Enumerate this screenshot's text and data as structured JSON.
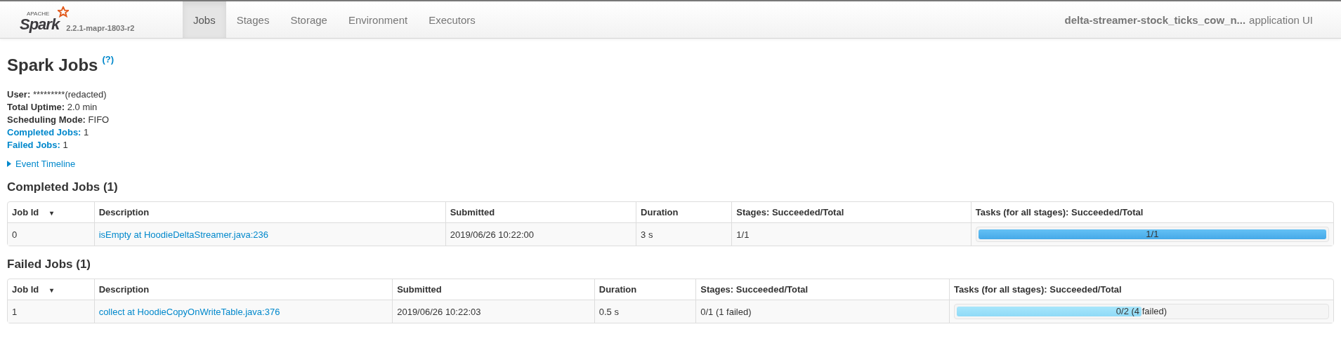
{
  "navbar": {
    "logo": {
      "small": "APACHE",
      "name": "Spark"
    },
    "version": "2.2.1-mapr-1803-r2",
    "tabs": [
      {
        "label": "Jobs",
        "selected": true
      },
      {
        "label": "Stages",
        "selected": false
      },
      {
        "label": "Storage",
        "selected": false
      },
      {
        "label": "Environment",
        "selected": false
      },
      {
        "label": "Executors",
        "selected": false
      }
    ],
    "app_name": "delta-streamer-stock_ticks_cow_n...",
    "app_suffix": "application UI"
  },
  "title": "Spark Jobs",
  "help": "(?)",
  "summary": [
    {
      "label": "User:",
      "value": "*********(redacted)",
      "link": false
    },
    {
      "label": "Total Uptime:",
      "value": "2.0 min",
      "link": false
    },
    {
      "label": "Scheduling Mode:",
      "value": "FIFO",
      "link": false
    },
    {
      "label": "Completed Jobs:",
      "value": "1",
      "link": true
    },
    {
      "label": "Failed Jobs:",
      "value": "1",
      "link": true
    }
  ],
  "event_timeline": {
    "label": "Event Timeline",
    "expanded": false
  },
  "sections": [
    {
      "title": "Completed Jobs (1)",
      "columns": [
        "Job Id",
        "Description",
        "Submitted",
        "Duration",
        "Stages: Succeeded/Total",
        "Tasks (for all stages): Succeeded/Total"
      ],
      "sort_mark": "▾",
      "rows": [
        {
          "id": "0",
          "description": "isEmpty at HoodieDeltaStreamer.java:236",
          "submitted": "2019/06/26 10:22:00",
          "duration": "3 s",
          "stages": "1/1",
          "tasks": {
            "label": "1/1",
            "level": 1,
            "kind": "completed"
          }
        }
      ]
    },
    {
      "title": "Failed Jobs (1)",
      "columns": [
        "Job Id",
        "Description",
        "Submitted",
        "Duration",
        "Stages: Succeeded/Total",
        "Tasks (for all stages): Succeeded/Total"
      ],
      "sort_mark": "▾",
      "rows": [
        {
          "id": "1",
          "description": "collect at HoodieCopyOnWriteTable.java:376",
          "submitted": "2019/06/26 10:22:03",
          "duration": "0.5 s",
          "stages": "0/1 (1 failed)",
          "tasks": {
            "label": "0/2 (4 failed)",
            "level": 0.5,
            "kind": "running"
          }
        }
      ]
    }
  ]
}
